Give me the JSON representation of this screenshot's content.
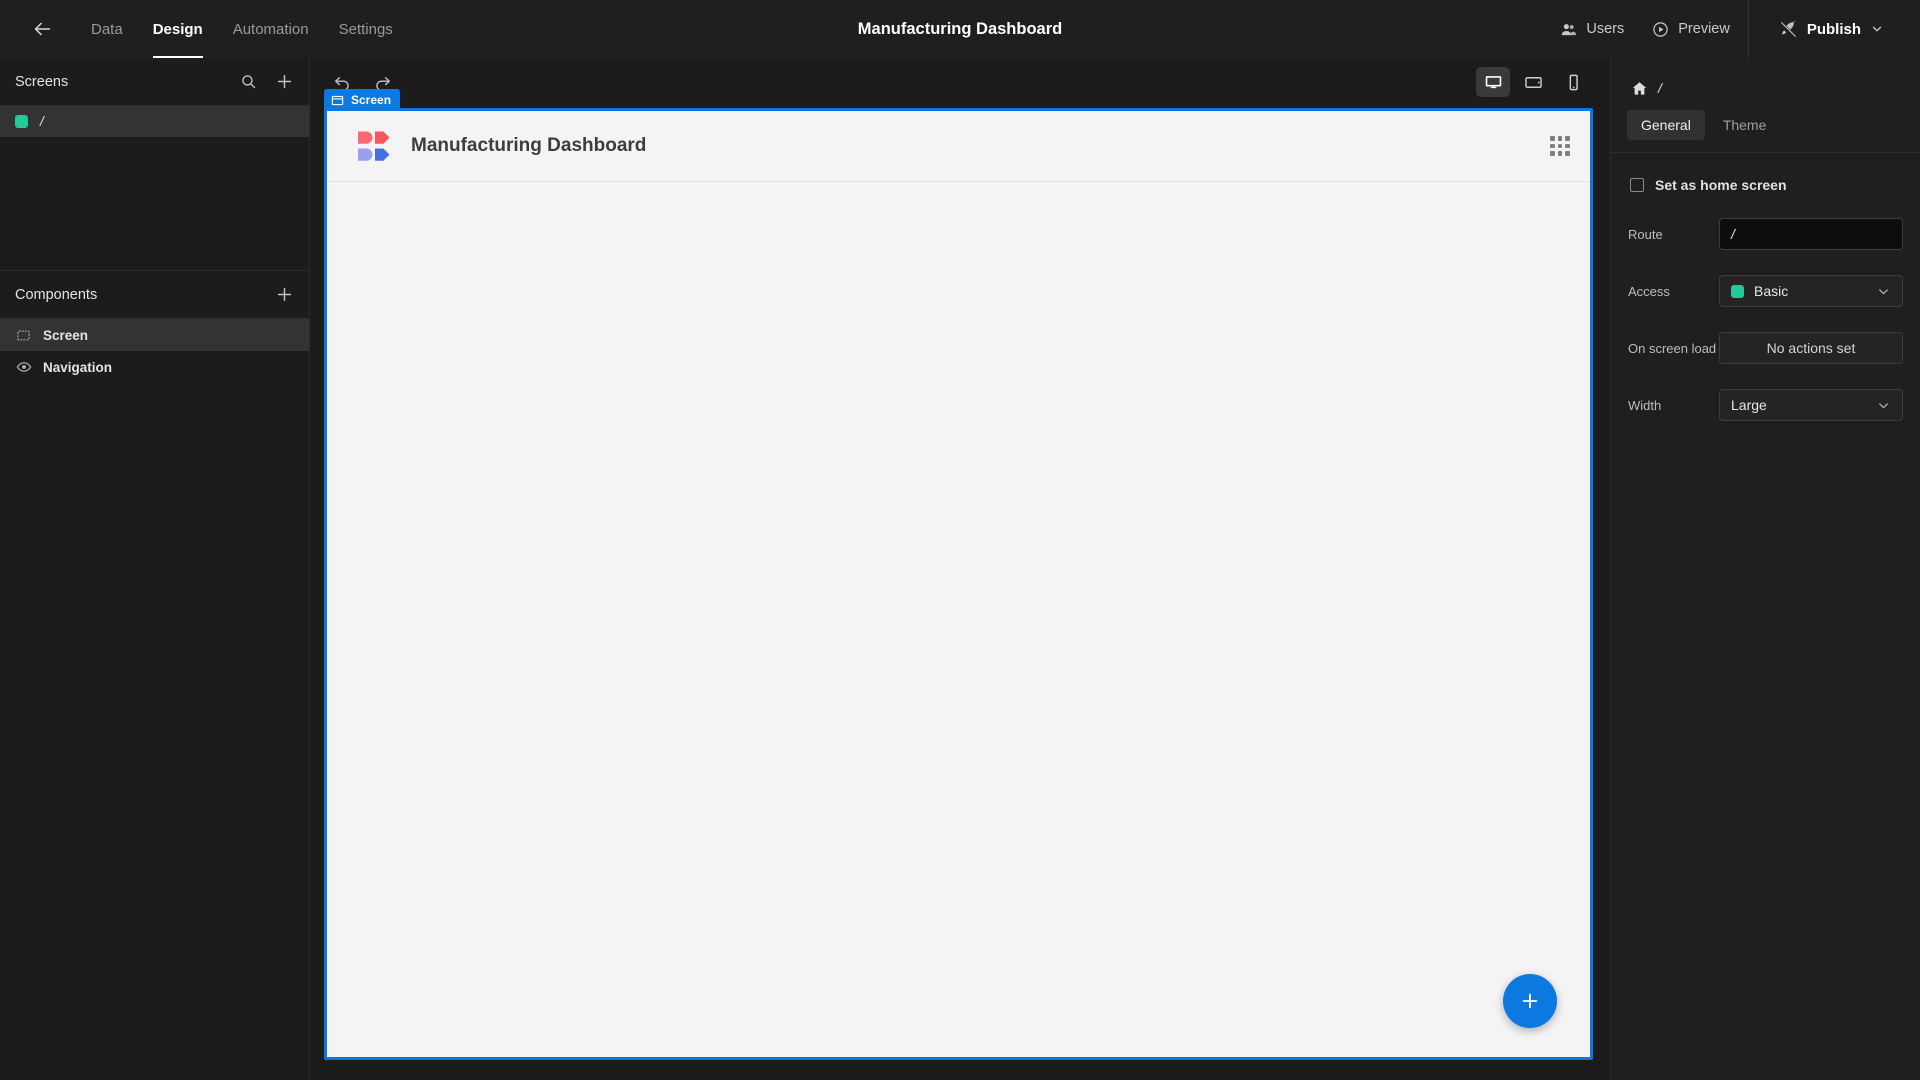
{
  "topbar": {
    "back_icon": "arrow-left-icon",
    "nav_tabs": [
      {
        "label": "Data",
        "active": false
      },
      {
        "label": "Design",
        "active": true
      },
      {
        "label": "Automation",
        "active": false
      },
      {
        "label": "Settings",
        "active": false
      }
    ],
    "title": "Manufacturing Dashboard",
    "users_label": "Users",
    "preview_label": "Preview",
    "publish_label": "Publish"
  },
  "sidebar": {
    "screens": {
      "title": "Screens",
      "search_icon": "search-icon",
      "add_icon": "plus-icon",
      "items": [
        {
          "route": "/",
          "color": "#22c99b",
          "selected": true
        }
      ]
    },
    "components": {
      "title": "Components",
      "add_icon": "plus-icon",
      "items": [
        {
          "label": "Screen",
          "icon": "screen-icon",
          "selected": true
        },
        {
          "label": "Navigation",
          "icon": "eye-icon",
          "selected": false
        }
      ]
    }
  },
  "canvas": {
    "toolbar": {
      "undo_icon": "undo-icon",
      "redo_icon": "redo-icon",
      "devices": [
        {
          "name": "desktop",
          "active": true
        },
        {
          "name": "tablet",
          "active": false
        },
        {
          "name": "mobile",
          "active": false
        }
      ]
    },
    "screen_badge": "Screen",
    "app_title": "Manufacturing Dashboard",
    "logo_colors": [
      "#fb6a73",
      "#f8555f",
      "#9aa0f0",
      "#4272e0"
    ],
    "grid_handle_icon": "grid-dots-icon",
    "fab_icon": "plus-icon"
  },
  "rightpanel": {
    "home_icon": "home-icon",
    "breadcrumb_route": "/",
    "tabs": [
      {
        "label": "General",
        "active": true
      },
      {
        "label": "Theme",
        "active": false
      }
    ],
    "home_screen_checkbox": "Set as home screen",
    "fields": {
      "route": {
        "label": "Route",
        "value": "/"
      },
      "access": {
        "label": "Access",
        "value": "Basic",
        "color": "#22c99b"
      },
      "on_screen_load": {
        "label": "On screen load",
        "value": "No actions set"
      },
      "width": {
        "label": "Width",
        "value": "Large"
      }
    }
  },
  "colors": {
    "accent": "#0b79e0",
    "green": "#22c99b",
    "bg": "#1c1c1c",
    "panel": "#1f1f1f"
  }
}
